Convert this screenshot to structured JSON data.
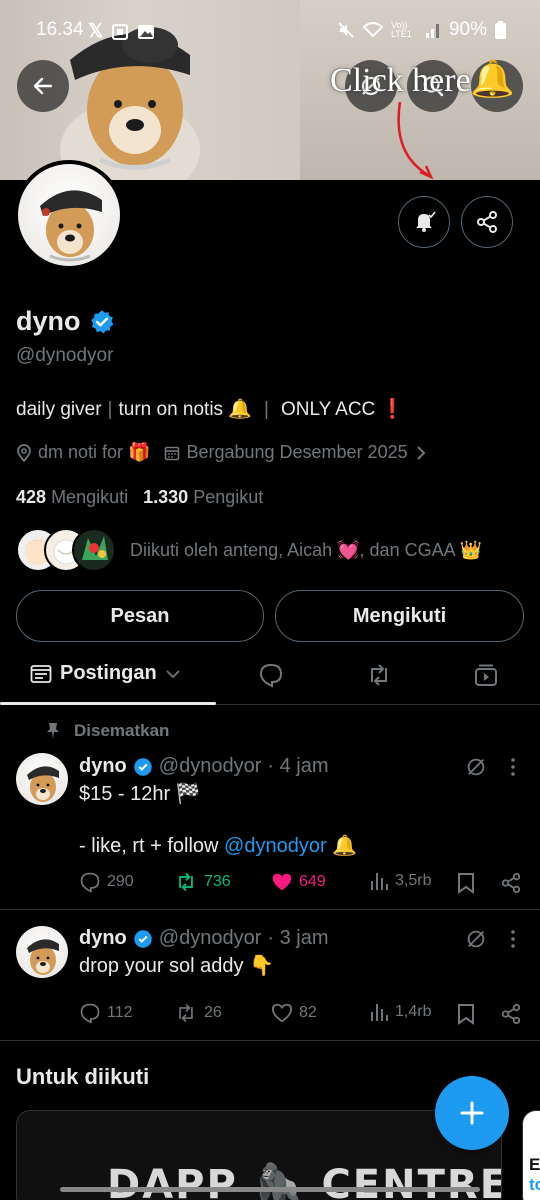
{
  "status_bar": {
    "time": "16.34",
    "network": "Vo)) LTE1",
    "battery": "90%"
  },
  "banner": {
    "overlay_text": "Click here"
  },
  "profile": {
    "name": "dyno",
    "handle": "@dynodyor",
    "bio": {
      "part1": "daily giver",
      "part2": "turn on notis 🔔",
      "part3": "ONLY ACC ❗"
    },
    "location": "dm noti for 🎁",
    "joined": "Bergabung Desember 2025",
    "following_count": "428",
    "following_label": "Mengikuti",
    "followers_count": "1.330",
    "followers_label": "Pengikut",
    "followed_by": "Diikuti oleh anteng, Aicah 💓, dan CGAA 👑"
  },
  "buttons": {
    "message": "Pesan",
    "following": "Mengikuti"
  },
  "tabs": {
    "posts": "Postingan"
  },
  "pinned_label": "Disematkan",
  "posts": [
    {
      "name": "dyno",
      "handle": "@dynodyor",
      "time": "· 4 jam",
      "line1": "$15 - 12hr 🏁",
      "line2_prefix": "- like, rt + follow ",
      "line2_mention": "@dynodyor",
      "line2_suffix": " 🔔",
      "replies": "290",
      "reposts": "736",
      "likes": "649",
      "views": "3,5rb"
    },
    {
      "name": "dyno",
      "handle": "@dynodyor",
      "time": "· 3 jam",
      "line1": "drop your sol addy 👇",
      "replies": "112",
      "reposts": "26",
      "likes": "82",
      "views": "1,4rb"
    }
  ],
  "suggestions": {
    "title": "Untuk diikuti",
    "card1_text": "DAPP 🦍 CENTRE",
    "card2_line1": "Er",
    "card2_line2": "to"
  },
  "colors": {
    "accent": "#1d9bf0",
    "repost_active": "#00ba7c",
    "like_active": "#f91880",
    "muted": "#71767b"
  }
}
